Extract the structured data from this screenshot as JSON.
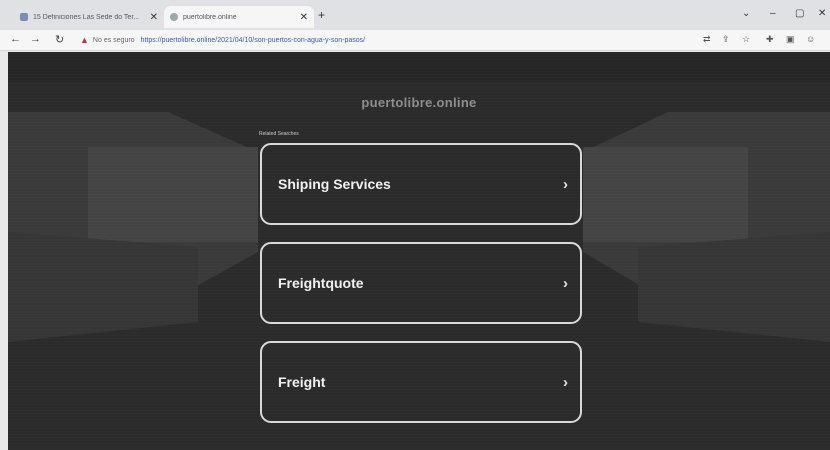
{
  "browser": {
    "tabs": [
      {
        "title": "15 Definiciones Las Sede do Ter..."
      },
      {
        "title": "puertolibre.online"
      }
    ],
    "new_tab": "+",
    "address": {
      "security": "No es seguro",
      "url": "https://puertolibre.online/2021/04/10/son-puertos-con-agua-y-son-pasos/"
    }
  },
  "page": {
    "site_title": "puertolibre.online",
    "related_label": "Related Searches",
    "items": [
      {
        "label": "Shiping Services"
      },
      {
        "label": "Freightquote"
      },
      {
        "label": "Freight"
      }
    ],
    "chevron": "›"
  },
  "colors": {
    "background": "#2b2b2b",
    "card_border": "#d9d9d9",
    "text": "#f1f1f1"
  }
}
